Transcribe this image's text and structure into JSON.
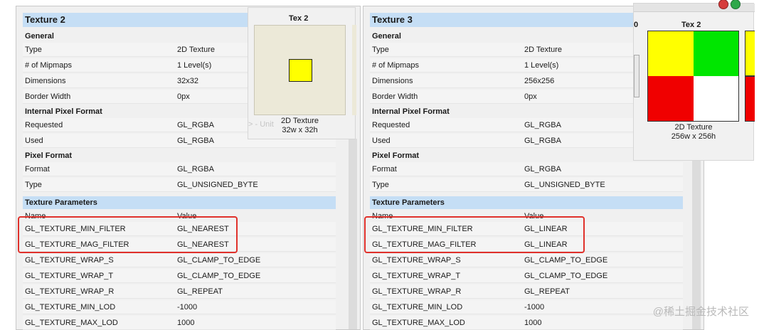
{
  "left": {
    "title": "Texture 2",
    "sections": {
      "general": "General",
      "internal": "Internal Pixel Format",
      "pixel": "Pixel Format",
      "params": "Texture Parameters"
    },
    "general_rows": [
      {
        "k": "Type",
        "v": "2D Texture"
      },
      {
        "k": "# of Mipmaps",
        "v": "1 Level(s)"
      },
      {
        "k": "Dimensions",
        "v": "32x32"
      },
      {
        "k": "Border Width",
        "v": "0px"
      }
    ],
    "internal_rows": [
      {
        "k": "Requested",
        "v": "GL_RGBA"
      },
      {
        "k": "Used",
        "v": "GL_RGBA"
      }
    ],
    "pixel_rows": [
      {
        "k": "Format",
        "v": "GL_RGBA"
      },
      {
        "k": "Type",
        "v": "GL_UNSIGNED_BYTE"
      }
    ],
    "param_header": {
      "k": "Name",
      "v": "Value"
    },
    "param_rows": [
      {
        "k": "GL_TEXTURE_MIN_FILTER",
        "v": "GL_NEAREST"
      },
      {
        "k": "GL_TEXTURE_MAG_FILTER",
        "v": "GL_NEAREST"
      },
      {
        "k": "GL_TEXTURE_WRAP_S",
        "v": "GL_CLAMP_TO_EDGE"
      },
      {
        "k": "GL_TEXTURE_WRAP_T",
        "v": "GL_CLAMP_TO_EDGE"
      },
      {
        "k": "GL_TEXTURE_WRAP_R",
        "v": "GL_REPEAT"
      },
      {
        "k": "GL_TEXTURE_MIN_LOD",
        "v": "-1000"
      },
      {
        "k": "GL_TEXTURE_MAX_LOD",
        "v": "1000"
      }
    ],
    "preview": {
      "title": "Tex 2",
      "type": "2D Texture",
      "size": "32w x 32h",
      "ghost": "> - Unit"
    }
  },
  "right": {
    "title": "Texture 3",
    "sections": {
      "general": "General",
      "internal": "Internal Pixel Format",
      "pixel": "Pixel Format",
      "params": "Texture Parameters"
    },
    "general_rows": [
      {
        "k": "Type",
        "v": "2D Texture"
      },
      {
        "k": "# of Mipmaps",
        "v": "1 Level(s)"
      },
      {
        "k": "Dimensions",
        "v": "256x256"
      },
      {
        "k": "Border Width",
        "v": "0px"
      }
    ],
    "internal_rows": [
      {
        "k": "Requested",
        "v": "GL_RGBA"
      },
      {
        "k": "Used",
        "v": "GL_RGBA"
      }
    ],
    "pixel_rows": [
      {
        "k": "Format",
        "v": "GL_RGBA"
      },
      {
        "k": "Type",
        "v": "GL_UNSIGNED_BYTE"
      }
    ],
    "param_header": {
      "k": "Name",
      "v": "Value"
    },
    "param_rows": [
      {
        "k": "GL_TEXTURE_MIN_FILTER",
        "v": "GL_LINEAR"
      },
      {
        "k": "GL_TEXTURE_MAG_FILTER",
        "v": "GL_LINEAR"
      },
      {
        "k": "GL_TEXTURE_WRAP_S",
        "v": "GL_CLAMP_TO_EDGE"
      },
      {
        "k": "GL_TEXTURE_WRAP_T",
        "v": "GL_CLAMP_TO_EDGE"
      },
      {
        "k": "GL_TEXTURE_WRAP_R",
        "v": "GL_REPEAT"
      },
      {
        "k": "GL_TEXTURE_MIN_LOD",
        "v": "-1000"
      },
      {
        "k": "GL_TEXTURE_MAX_LOD",
        "v": "1000"
      }
    ],
    "preview": {
      "title": "Tex 2",
      "type": "2D Texture",
      "size": "256w x 256h",
      "edge_digit": "0"
    }
  },
  "watermark": "@稀土掘金技术社区",
  "colors": {
    "highlight": "#e0312b",
    "header_blue": "#c5def5",
    "tex_yellow": "#ffff00",
    "tex_green": "#00e600",
    "tex_red": "#f00000",
    "tex_white": "#ffffff"
  }
}
